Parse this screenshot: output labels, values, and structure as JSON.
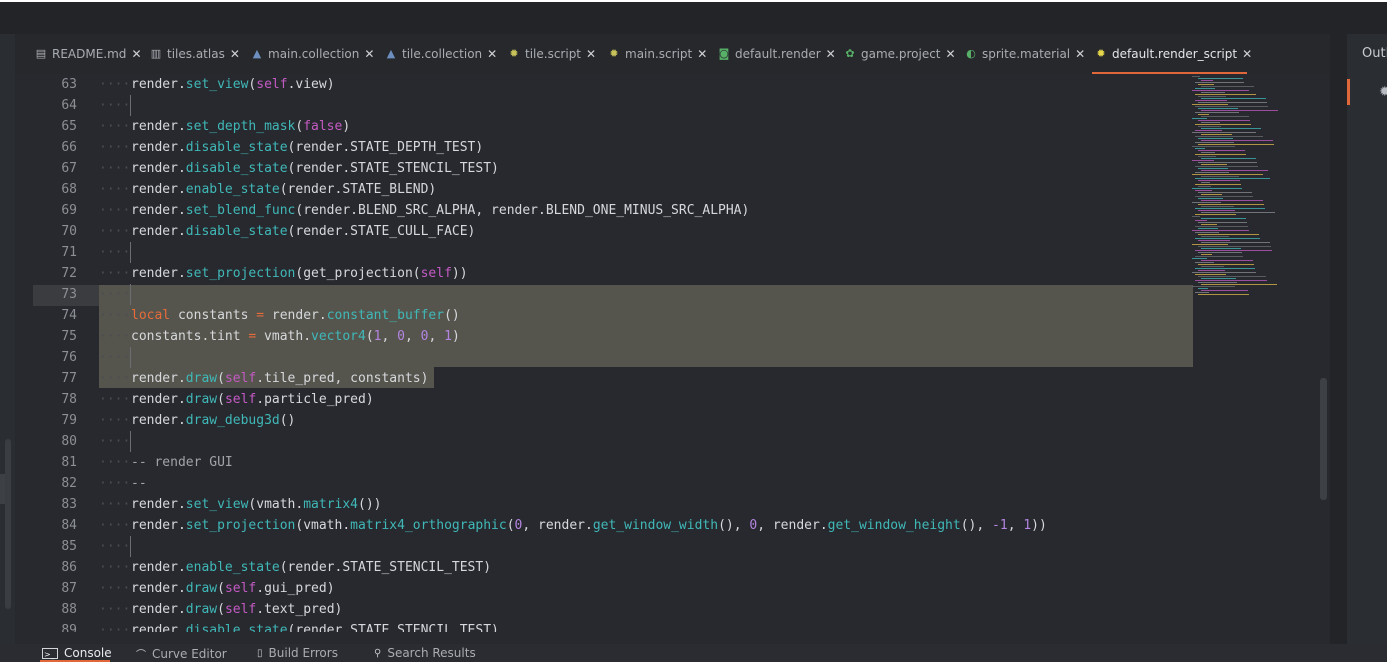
{
  "tabs": [
    {
      "label": "README.md",
      "icon": "document-icon"
    },
    {
      "label": "tiles.atlas",
      "icon": "atlas-icon"
    },
    {
      "label": "main.collection",
      "icon": "collection-icon"
    },
    {
      "label": "tile.collection",
      "icon": "collection-icon"
    },
    {
      "label": "tile.script",
      "icon": "gear-icon"
    },
    {
      "label": "main.script",
      "icon": "gear-icon"
    },
    {
      "label": "default.render",
      "icon": "render-icon"
    },
    {
      "label": "game.project",
      "icon": "project-icon"
    },
    {
      "label": "sprite.material",
      "icon": "material-icon"
    },
    {
      "label": "default.render_script",
      "icon": "gear-icon",
      "active": true
    }
  ],
  "tab_close_glyph": "✕",
  "code_lines": [
    {
      "n": "63",
      "t": "render.set_view(self.view)"
    },
    {
      "n": "64",
      "t": ""
    },
    {
      "n": "65",
      "t": "render.set_depth_mask(false)"
    },
    {
      "n": "66",
      "t": "render.disable_state(render.STATE_DEPTH_TEST)"
    },
    {
      "n": "67",
      "t": "render.disable_state(render.STATE_STENCIL_TEST)"
    },
    {
      "n": "68",
      "t": "render.enable_state(render.STATE_BLEND)"
    },
    {
      "n": "69",
      "t": "render.set_blend_func(render.BLEND_SRC_ALPHA, render.BLEND_ONE_MINUS_SRC_ALPHA)"
    },
    {
      "n": "70",
      "t": "render.disable_state(render.STATE_CULL_FACE)"
    },
    {
      "n": "71",
      "t": ""
    },
    {
      "n": "72",
      "t": "render.set_projection(get_projection(self))"
    },
    {
      "n": "73",
      "t": ""
    },
    {
      "n": "74",
      "t": "local constants = render.constant_buffer()"
    },
    {
      "n": "75",
      "t": "constants.tint = vmath.vector4(1, 0, 0, 1)"
    },
    {
      "n": "76",
      "t": ""
    },
    {
      "n": "77",
      "t": "render.draw(self.tile_pred, constants)"
    },
    {
      "n": "78",
      "t": "render.draw(self.particle_pred)"
    },
    {
      "n": "79",
      "t": "render.draw_debug3d()"
    },
    {
      "n": "80",
      "t": ""
    },
    {
      "n": "81",
      "t": "-- render GUI"
    },
    {
      "n": "82",
      "t": "--"
    },
    {
      "n": "83",
      "t": "render.set_view(vmath.matrix4())"
    },
    {
      "n": "84",
      "t": "render.set_projection(vmath.matrix4_orthographic(0, render.get_window_width(), 0, render.get_window_height(), -1, 1))"
    },
    {
      "n": "85",
      "t": ""
    },
    {
      "n": "86",
      "t": "render.enable_state(render.STATE_STENCIL_TEST)"
    },
    {
      "n": "87",
      "t": "render.draw(self.gui_pred)"
    },
    {
      "n": "88",
      "t": "render.draw(self.text_pred)"
    },
    {
      "n": "89",
      "t": "render.disable_state(render.STATE_STENCIL_TEST)"
    }
  ],
  "bottom_tabs": [
    {
      "label": "Console",
      "icon": "console-icon",
      "active": true
    },
    {
      "label": "Curve Editor",
      "icon": "curve-icon"
    },
    {
      "label": "Build Errors",
      "icon": "error-icon"
    },
    {
      "label": "Search Results",
      "icon": "search-icon"
    }
  ],
  "right_panel": {
    "title": "Outline"
  },
  "colors": {
    "accent": "#e0673a",
    "function": "#40b8b8",
    "self": "#c45ac4",
    "keyword": "#e86b3a",
    "number": "#b384e0",
    "selection": "#55554d"
  }
}
